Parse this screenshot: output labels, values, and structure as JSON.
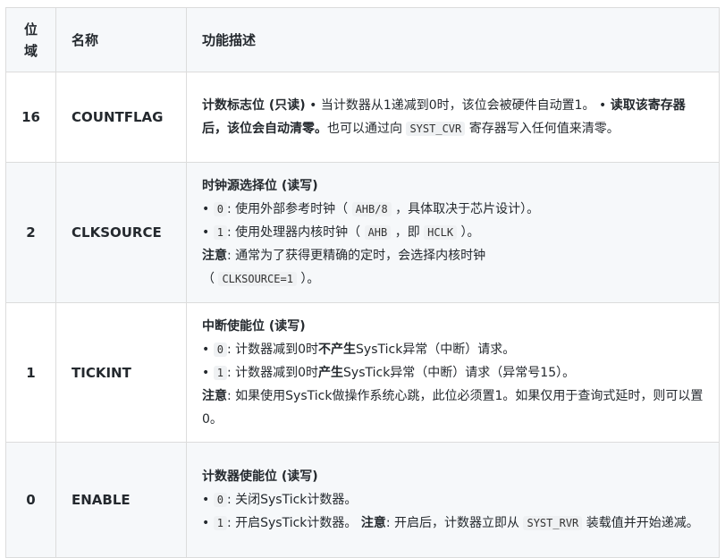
{
  "header": {
    "bit": "位\n域",
    "bit_top": "位",
    "bit_bottom": "域",
    "name": "名称",
    "desc": "功能描述"
  },
  "rows": [
    {
      "bit": "16",
      "name": "COUNTFLAG",
      "title": "计数标志位 (只读)",
      "p1": " • 当计数器从1递减到0时，该位会被硬件自动置1。 • ",
      "p2_bold": "读取该寄存器后，该位会自动清零。",
      "p3": "也可以通过向 ",
      "code1": "SYST_CVR",
      "p4": " 寄存器写入任何值来清零。"
    },
    {
      "bit": "2",
      "name": "CLKSOURCE",
      "title": "时钟源选择位 (读写)",
      "l1_pre": "• ",
      "l1_code": "0",
      "l1_mid": ": 使用外部参考时钟（ ",
      "l1_code2": "AHB/8",
      "l1_post": " ，具体取决于芯片设计）。",
      "l2_pre": "• ",
      "l2_code": "1",
      "l2_mid": ": 使用处理器内核时钟（ ",
      "l2_code2": "AHB",
      "l2_mid2": " ，即 ",
      "l2_code3": "HCLK",
      "l2_post": " ）。",
      "note_label": "注意",
      "note_text": ": 通常为了获得更精确的定时，会选择内核时钟",
      "note_pre": "（ ",
      "note_code": "CLKSOURCE=1",
      "note_post": " ）。"
    },
    {
      "bit": "1",
      "name": "TICKINT",
      "title": "中断使能位 (读写)",
      "l1_pre": "• ",
      "l1_code": "0",
      "l1_mid": ": 计数器减到0时",
      "l1_bold": "不产生",
      "l1_post": "SysTick异常（中断）请求。",
      "l2_pre": "• ",
      "l2_code": "1",
      "l2_mid": ": 计数器减到0时",
      "l2_bold": "产生",
      "l2_post": "SysTick异常（中断）请求（异常号15）。",
      "note_label": "注意",
      "note_text": ": 如果使用SysTick做操作系统心跳，此位必须置1。如果仅用于查询式延时，则可以置0。"
    },
    {
      "bit": "0",
      "name": "ENABLE",
      "title": "计数器使能位 (读写)",
      "l1_pre": "• ",
      "l1_code": "0",
      "l1_post": ": 关闭SysTick计数器。",
      "l2_pre": "• ",
      "l2_code": "1",
      "l2_mid": ": 开启SysTick计数器。 ",
      "note_label": "注意",
      "note_text": ": 开启后，计数器立即从 ",
      "note_code": "SYST_RVR",
      "note_post": " 装载值并开始递减。"
    }
  ]
}
